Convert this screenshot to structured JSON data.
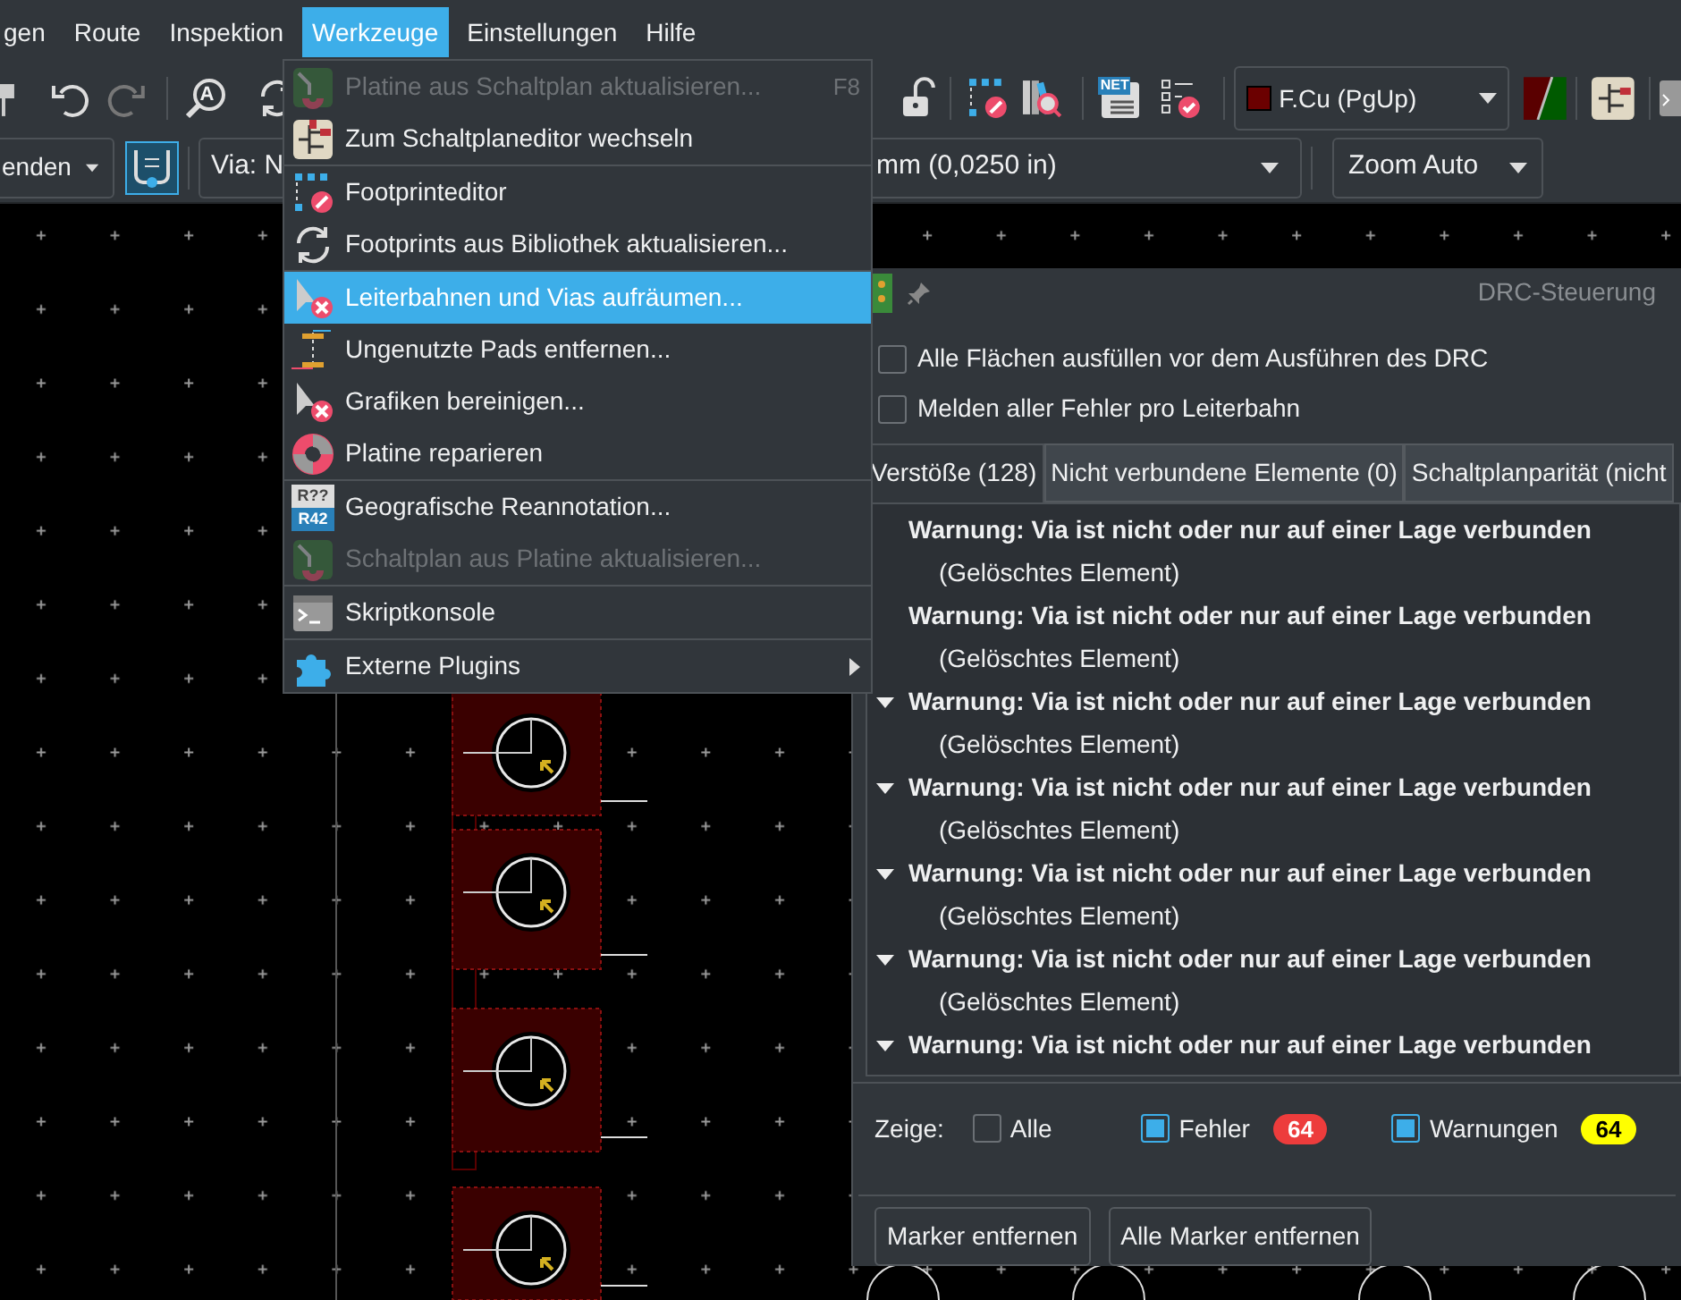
{
  "menubar": [
    {
      "label": "gen",
      "selected": false
    },
    {
      "label": "Route",
      "selected": false
    },
    {
      "label": "Inspektion",
      "selected": false
    },
    {
      "label": "Werkzeuge",
      "selected": true
    },
    {
      "label": "Einstellungen",
      "selected": false
    },
    {
      "label": "Hilfe",
      "selected": false
    }
  ],
  "toolbar": {
    "annotate_icon_letter": "A",
    "netlist_icon_label": "NET",
    "layer_dropdown": "F.Cu (PgUp)"
  },
  "toolbar2": {
    "track_width": "enden",
    "track_toggle": {
      "on": true
    },
    "via_size": "Via: N",
    "grid": "mm (0,0250 in)",
    "zoom": "Zoom Auto"
  },
  "tools_menu": [
    [
      {
        "label": "Platine aus Schaltplan aktualisieren...",
        "shortcut": "F8",
        "disabled": true,
        "selected": false
      },
      {
        "label": "Zum Schaltplaneditor wechseln",
        "disabled": false,
        "selected": false
      }
    ],
    [
      {
        "label": "Footprinteditor",
        "disabled": false,
        "selected": false
      },
      {
        "label": "Footprints aus Bibliothek aktualisieren...",
        "disabled": false,
        "selected": false
      }
    ],
    [
      {
        "label": "Leiterbahnen und Vias aufräumen...",
        "disabled": false,
        "selected": true
      },
      {
        "label": "Ungenutzte Pads entfernen...",
        "disabled": false,
        "selected": false
      },
      {
        "label": "Grafiken bereinigen...",
        "disabled": false,
        "selected": false
      },
      {
        "label": "Platine reparieren",
        "disabled": false,
        "selected": false
      }
    ],
    [
      {
        "label": "Geografische Reannotation...",
        "icon_labels": [
          "R??",
          "R42"
        ],
        "disabled": false,
        "selected": false
      },
      {
        "label": "Schaltplan aus Platine aktualisieren...",
        "disabled": true,
        "selected": false
      }
    ],
    [
      {
        "label": "Skriptkonsole",
        "disabled": false,
        "selected": false
      }
    ],
    [
      {
        "label": "Externe Plugins",
        "submenu": true,
        "disabled": false,
        "selected": false
      }
    ]
  ],
  "drc": {
    "title": "DRC-Steuerung",
    "options": [
      {
        "label": "Alle Flächen ausfüllen vor dem Ausführen des DRC",
        "checked": false
      },
      {
        "label": "Melden aller Fehler pro Leiterbahn",
        "checked": false
      }
    ],
    "tabs": [
      {
        "label": "Verstöße (128)",
        "selected": true
      },
      {
        "label": "Nicht verbundene Elemente (0)",
        "selected": false
      },
      {
        "label": "Schaltplanparität (nicht",
        "selected": false
      }
    ],
    "violations": [
      {
        "title": "Warnung: Via ist nicht oder nur auf einer Lage verbunden",
        "toggle": false,
        "children": [
          "(Gelöschtes Element)"
        ]
      },
      {
        "title": "Warnung: Via ist nicht oder nur auf einer Lage verbunden",
        "toggle": false,
        "children": [
          "(Gelöschtes Element)"
        ]
      },
      {
        "title": "Warnung: Via ist nicht oder nur auf einer Lage verbunden",
        "toggle": true,
        "children": [
          "(Gelöschtes Element)"
        ]
      },
      {
        "title": "Warnung: Via ist nicht oder nur auf einer Lage verbunden",
        "toggle": true,
        "children": [
          "(Gelöschtes Element)"
        ]
      },
      {
        "title": "Warnung: Via ist nicht oder nur auf einer Lage verbunden",
        "toggle": true,
        "children": [
          "(Gelöschtes Element)"
        ]
      },
      {
        "title": "Warnung: Via ist nicht oder nur auf einer Lage verbunden",
        "toggle": true,
        "children": [
          "(Gelöschtes Element)"
        ]
      },
      {
        "title": "Warnung: Via ist nicht oder nur auf einer Lage verbunden",
        "toggle": true
      }
    ],
    "filter_label": "Zeige:",
    "filters": [
      {
        "label": "Alle",
        "checked": false
      },
      {
        "label": "Fehler",
        "checked": true,
        "count": "64",
        "color": "#ed3c3c"
      },
      {
        "label": "Warnungen",
        "checked": true,
        "count": "64",
        "color": "#ffff00"
      }
    ],
    "buttons": [
      "Marker entfernen",
      "Alle Marker entfernen"
    ]
  }
}
